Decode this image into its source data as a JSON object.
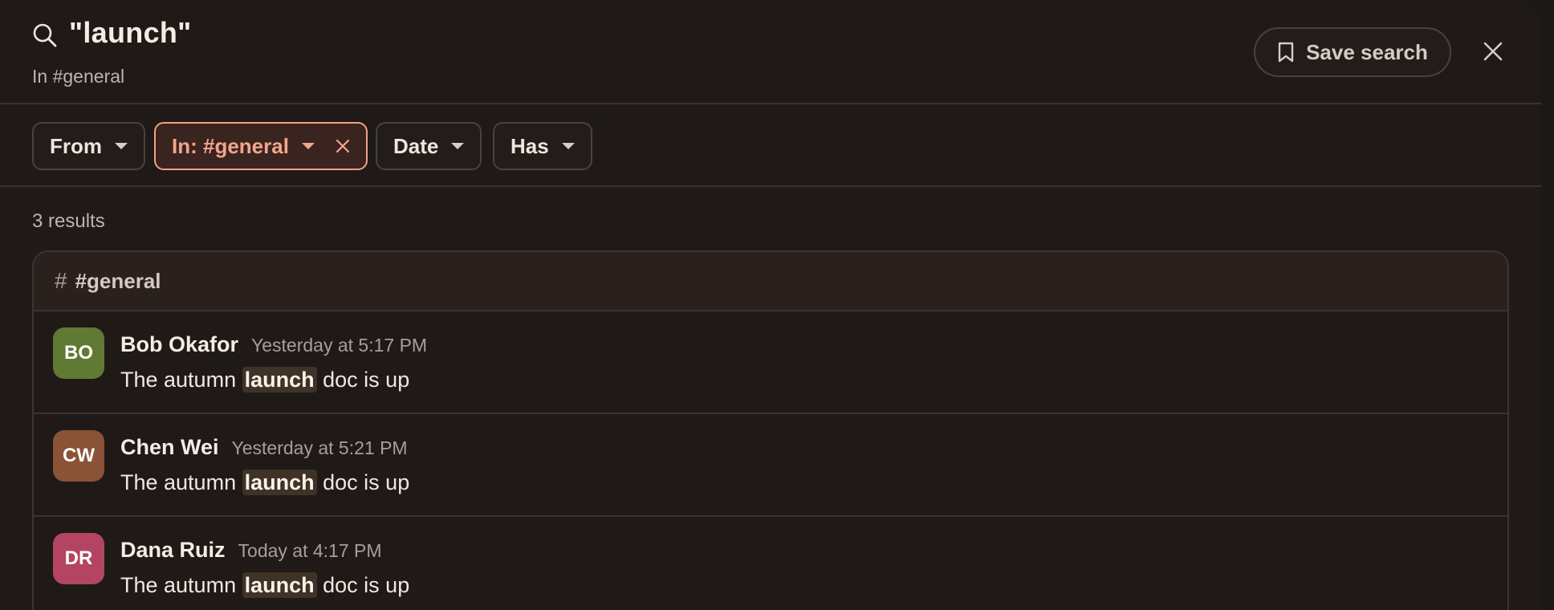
{
  "header": {
    "query": "\"launch\"",
    "scope": "In #general",
    "save_label": "Save search"
  },
  "filters": [
    {
      "label": "From",
      "active": false
    },
    {
      "label": "In: #general",
      "active": true
    },
    {
      "label": "Date",
      "active": false
    },
    {
      "label": "Has",
      "active": false
    }
  ],
  "results": {
    "count_label": "3 results",
    "group": {
      "hash": "#",
      "name": "#general"
    },
    "messages": [
      {
        "initials": "BO",
        "author": "Bob Okafor",
        "time": "Yesterday at 5:17 PM",
        "before": "The autumn",
        "match": "launch",
        "after": "doc is up",
        "avatar_color": "#5e7a33"
      },
      {
        "initials": "CW",
        "author": "Chen Wei",
        "time": "Yesterday at 5:21 PM",
        "before": "The autumn",
        "match": "launch",
        "after": "doc is up",
        "avatar_color": "#8a5236"
      },
      {
        "initials": "DR",
        "author": "Dana Ruiz",
        "time": "Today at 4:17 PM",
        "before": "The autumn",
        "match": "launch",
        "after": "doc is up",
        "avatar_color": "#b34562"
      }
    ]
  },
  "colors": {
    "accent": "#f3a58b",
    "highlight": "#3e3326"
  }
}
